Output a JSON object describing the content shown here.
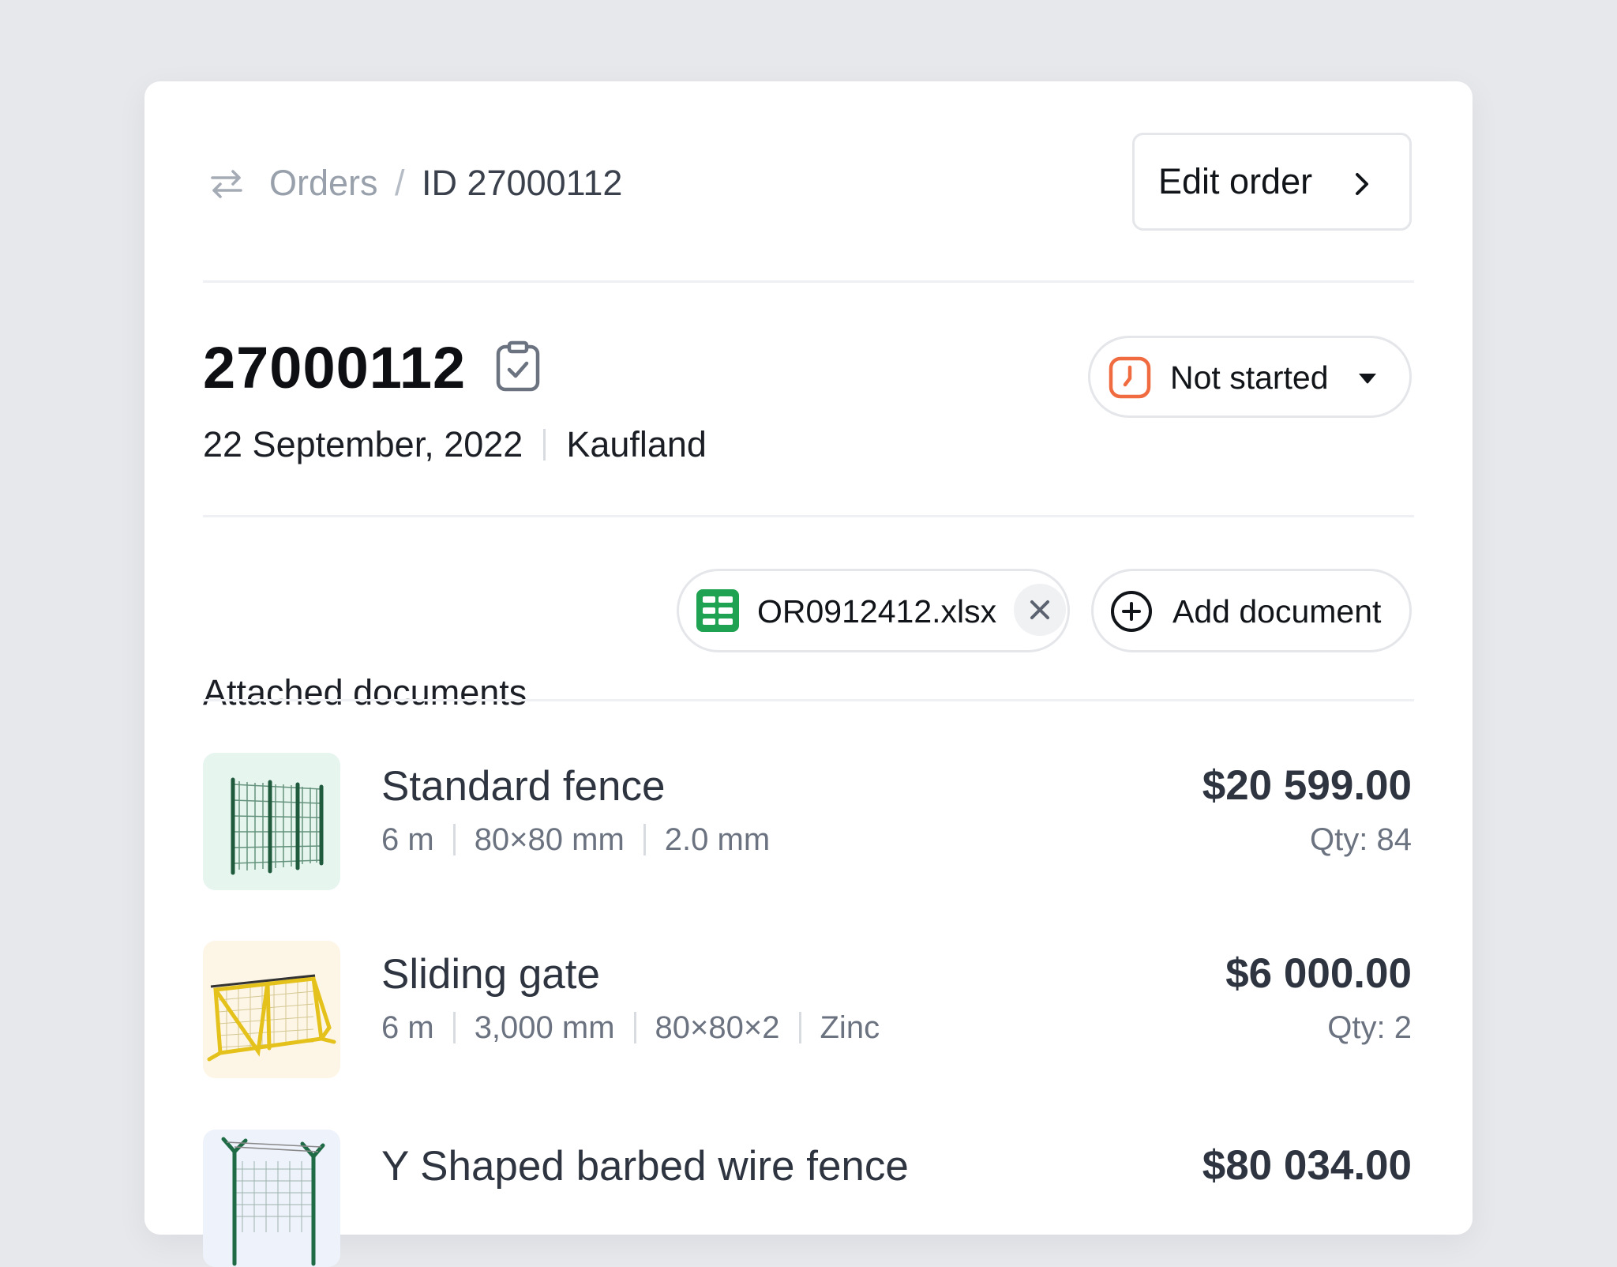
{
  "breadcrumb": {
    "icon": "swap-arrows-icon",
    "orders": "Orders",
    "separator": "/",
    "current": "ID 27000112"
  },
  "edit_button": {
    "label": "Edit order",
    "icon": "chevron-right-icon"
  },
  "order": {
    "id": "27000112",
    "date": "22 September, 2022",
    "customer": "Kaufland"
  },
  "status": {
    "label": "Not started",
    "icon": "clock-icon",
    "color": "#f06b3f"
  },
  "documents": {
    "label": "Attached documents",
    "files": [
      {
        "name": "OR0912412.xlsx",
        "icon": "spreadsheet-icon",
        "color": "#1fa352"
      }
    ],
    "add_label": "Add document"
  },
  "products": [
    {
      "name": "Standard fence",
      "attrs": [
        "6 m",
        "80×80 mm",
        "2.0 mm"
      ],
      "price": "$20 599.00",
      "qty": "Qty: 84",
      "thumb_bg": "#e6f5ee"
    },
    {
      "name": "Sliding gate",
      "attrs": [
        "6 m",
        "3,000 mm",
        "80×80×2",
        "Zinc"
      ],
      "price": "$6 000.00",
      "qty": "Qty: 2",
      "thumb_bg": "#fdf6e6"
    },
    {
      "name": "Y Shaped barbed wire fence",
      "attrs": [],
      "price": "$80 034.00",
      "qty": "",
      "thumb_bg": "#eef2fb"
    }
  ]
}
